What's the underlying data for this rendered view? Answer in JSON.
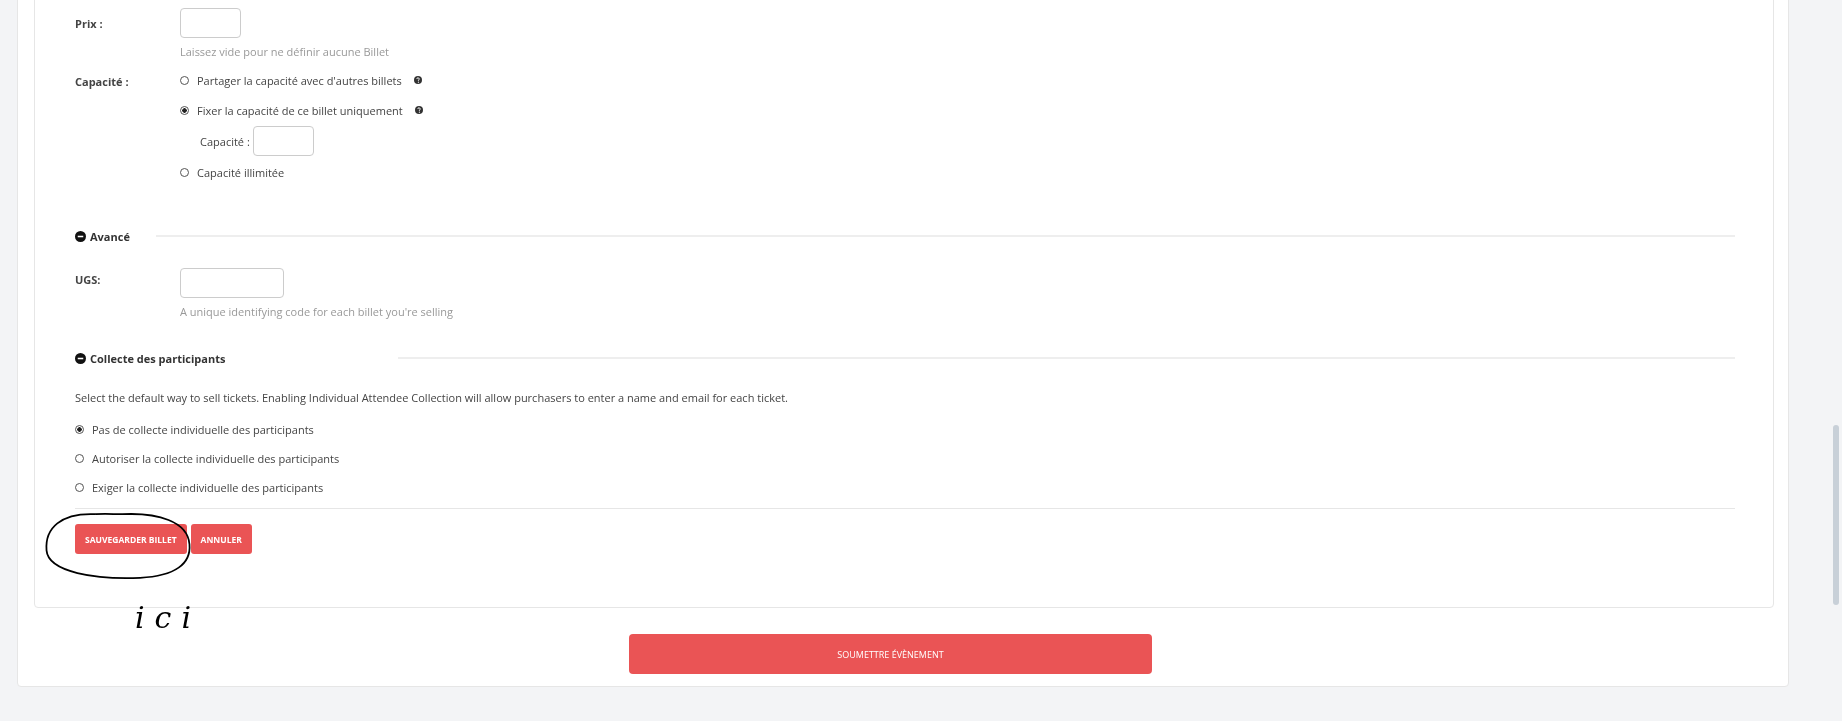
{
  "price": {
    "label": "Prix :",
    "hint": "Laissez vide pour ne définir aucune Billet"
  },
  "capacity": {
    "label": "Capacité :",
    "options": [
      {
        "label": "Partager la capacité avec d'autres billets",
        "selected": false,
        "help": true
      },
      {
        "label": "Fixer la capacité de ce billet uniquement",
        "selected": true,
        "help": true,
        "sub_label": "Capacité :"
      },
      {
        "label": "Capacité illimitée",
        "selected": false,
        "help": false
      }
    ]
  },
  "advanced": {
    "title": "Avancé",
    "expanded": true,
    "sku_label": "UGS:",
    "sku_hint": "A unique identifying code for each billet you're selling"
  },
  "attendees": {
    "title": "Collecte des participants",
    "expanded": true,
    "description": "Select the default way to sell tickets. Enabling Individual Attendee Collection will allow purchasers to enter a name and email for each ticket.",
    "options": [
      {
        "label": "Pas de collecte individuelle des participants",
        "selected": true
      },
      {
        "label": "Autoriser la collecte individuelle des participants",
        "selected": false
      },
      {
        "label": "Exiger la collecte individuelle des participants",
        "selected": false
      }
    ]
  },
  "buttons": [
    "SAUVEGARDER BILLET",
    "ANNULER"
  ],
  "annotation": {
    "text": "ici"
  },
  "submit": "SOUMETTRE ÉVÈNEMENT"
}
